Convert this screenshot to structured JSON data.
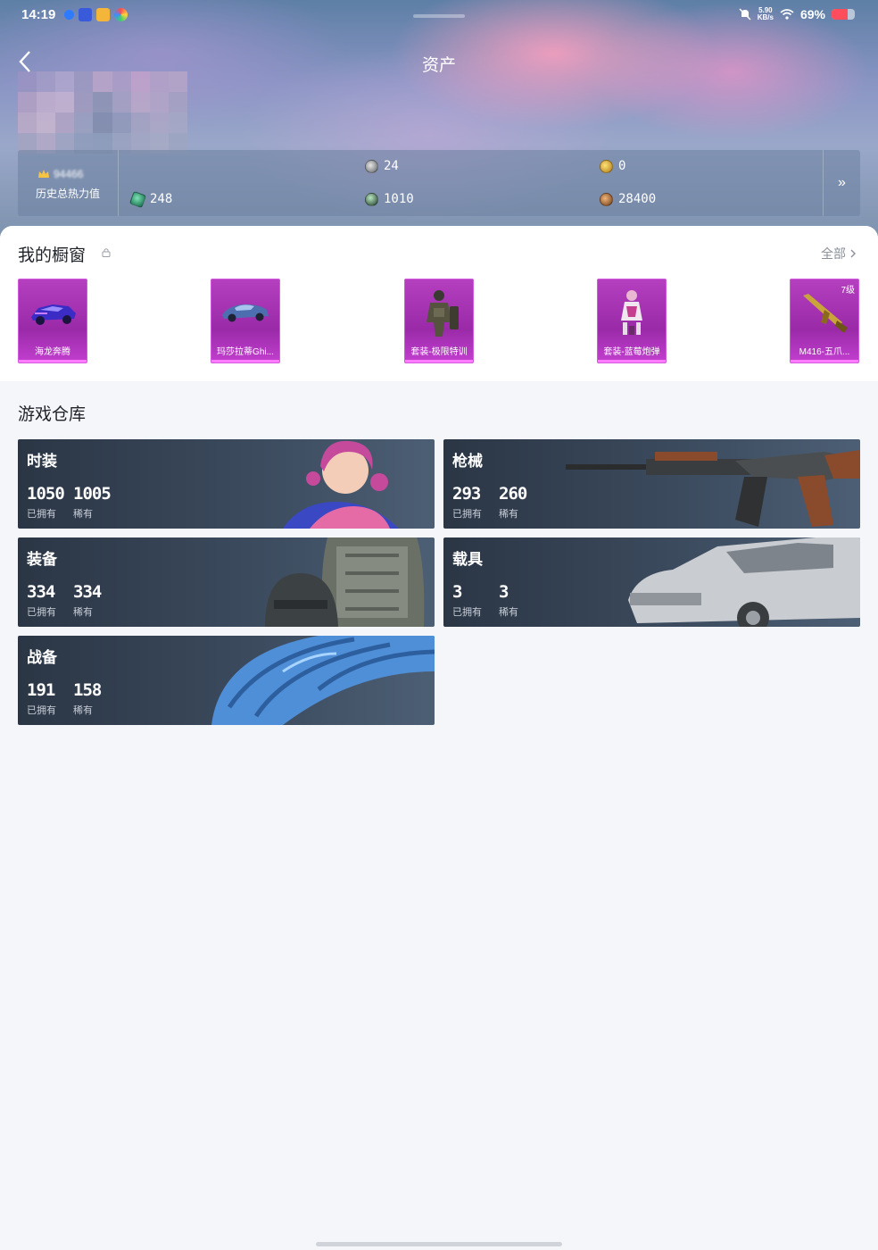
{
  "status_bar": {
    "time": "14:19",
    "net_speed_value": "5.90",
    "net_speed_unit": "KB/s",
    "battery_percent": "69%",
    "battery_level": 0.69
  },
  "header": {
    "title": "资产"
  },
  "stats": {
    "heat_value": "94466",
    "heat_label": "历史总热力值",
    "items": [
      {
        "value": "24",
        "icon": "silver-coin-icon"
      },
      {
        "value": "0",
        "icon": "gold-coin-icon"
      },
      {
        "value": "248",
        "icon": "green-gem-icon"
      },
      {
        "value": "1010",
        "icon": "dark-orb-icon"
      },
      {
        "value": "28400",
        "icon": "bronze-coin-icon"
      }
    ]
  },
  "showcase": {
    "title": "我的橱窗",
    "see_all": "全部",
    "items": [
      {
        "label": "海龙奔腾"
      },
      {
        "label": "玛莎拉蒂Ghi..."
      },
      {
        "label": "套装-极限特训"
      },
      {
        "label": "套装-蓝莓炮弹"
      },
      {
        "label": "M416-五爪...",
        "level": "7级"
      }
    ]
  },
  "warehouse": {
    "title": "游戏仓库",
    "owned_label": "已拥有",
    "rare_label": "稀有",
    "cards": [
      {
        "title": "时装",
        "owned": "1050",
        "rare": "1005"
      },
      {
        "title": "枪械",
        "owned": "293",
        "rare": "260"
      },
      {
        "title": "装备",
        "owned": "334",
        "rare": "334"
      },
      {
        "title": "载具",
        "owned": "3",
        "rare": "3"
      },
      {
        "title": "战备",
        "owned": "191",
        "rare": "158"
      }
    ]
  }
}
